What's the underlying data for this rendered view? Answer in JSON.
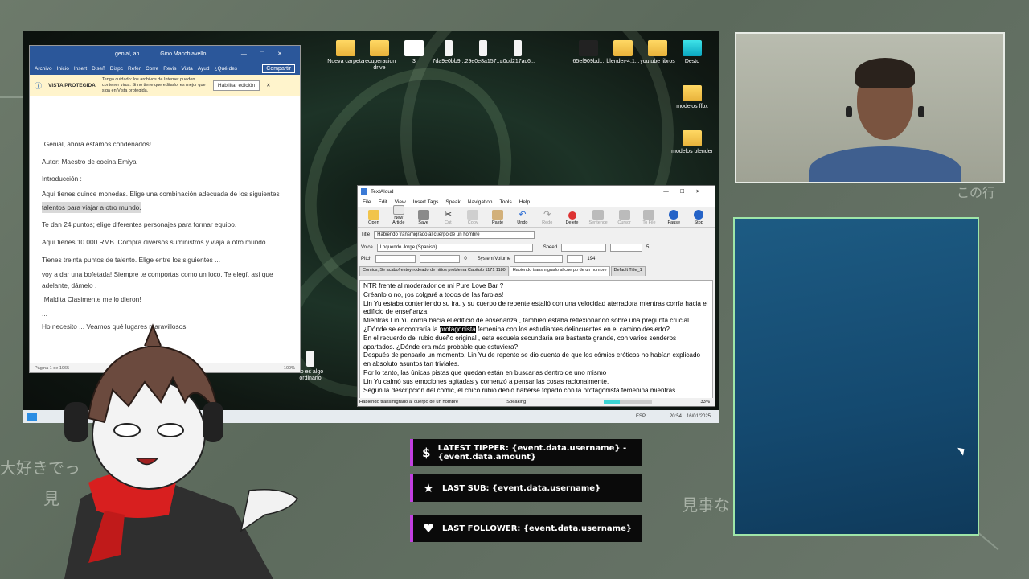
{
  "desktop": {
    "icons": [
      {
        "label": "Nueva carpeta",
        "kind": "folder"
      },
      {
        "label": "recuperacion drive",
        "kind": "folder"
      },
      {
        "label": "3",
        "kind": "app"
      },
      {
        "label": "7da9e0bb9...",
        "kind": "file"
      },
      {
        "label": "29e0e8a157...",
        "kind": "file"
      },
      {
        "label": "c0cd217ac6...",
        "kind": "file"
      },
      {
        "label": "65ef909bd...",
        "kind": "app"
      },
      {
        "label": "blender-4.1...",
        "kind": "folder"
      },
      {
        "label": "youtube libros",
        "kind": "folder"
      },
      {
        "label": "Desto",
        "kind": "app"
      },
      {
        "label": "modelos ffbx",
        "kind": "folder"
      },
      {
        "label": "modelos blender",
        "kind": "folder"
      },
      {
        "label": "no es algo ordinario",
        "kind": "file"
      }
    ],
    "taskbar": {
      "lang": "ESP",
      "time": "20:54",
      "date": "16/01/2025"
    }
  },
  "word": {
    "title": "genial, ah...",
    "user": "Gino Macchiavello",
    "tabs": [
      "Archivo",
      "Inicio",
      "Insert",
      "Diseñ",
      "Dispc",
      "Refer",
      "Corre",
      "Revis",
      "Vista",
      "Ayud",
      "¿Qué des"
    ],
    "share_label": "Compartir",
    "protected_title": "VISTA PROTEGIDA",
    "protected_msg": "Tenga cuidado: los archivos de Internet pueden contener virus. Si no tiene que editarlo, es mejor que siga en Vista protegida.",
    "enable_button": "Habilitar edición",
    "lines": [
      "¡Genial, ahora estamos condenados!",
      "Autor: Maestro de cocina Emiya",
      "Introducción :",
      "Aquí tienes quince monedas. Elige una combinación adecuada de los siguientes",
      "talentos para viajar a otro mundo.",
      "Te dan 24 puntos; elige diferentes personajes para formar equipo.",
      "Aquí tienes 10.000 RMB. Compra diversos suministros y viaja a otro mundo.",
      "Tienes treinta puntos de talento. Elige entre los siguientes ...",
      "voy a dar una bofetada! Siempre te comportas como un loco. Te elegí, así que",
      "adelante, dámelo .",
      "¡Maldita Clasimente me lo dieron!",
      "...",
      "Ho necesito ... Veamos qué lugares maravillosos"
    ],
    "status_page": "Página 1 de 1965",
    "zoom": "100%"
  },
  "textaloud": {
    "title": "TextAloud",
    "menu": [
      "File",
      "Edit",
      "View",
      "Insert Tags",
      "Speak",
      "Navigation",
      "Tools",
      "Help"
    ],
    "toolbar": [
      "Open",
      "New Article",
      "Save",
      "Cut",
      "Copy",
      "Paste",
      "Undo",
      "Redo",
      "Delete",
      "Sentence",
      "Cursor",
      "To File",
      "Pause",
      "Stop"
    ],
    "title_label": "Title",
    "title_value": "Habiendo transmigrado al cuerpo de un hombre",
    "voice_label": "Voice",
    "voice_value": "Loquendo Jorge (Spanish)",
    "speed_label": "Speed",
    "speed_value": "5",
    "pitch_label": "Pitch",
    "pitch_value": "0",
    "volume_label": "System Volume",
    "volume_value": "194",
    "tabs": [
      "Comics; Se acabo! estoy rodeado de niños problema Capitulo 1171 1180",
      "Habiendo transmigrado al cuerpo de un hombre",
      "Default Title_1"
    ],
    "text_before": "NTR frente al moderador de mi Pure Love Bar ?\nCréanlo o no, ¡os colgaré a todos de las farolas!\nLin Yu estaba conteniendo su ira, y su cuerpo de repente estalló con una velocidad aterradora mientras corría hacia el edificio de enseñanza.\nMientras Lin Yu corría hacia el edificio de enseñanza , también estaba reflexionando sobre una pregunta crucial.\n¿Dónde se encontraría la ",
    "highlight": "protagonista",
    "text_after": " femenina con los estudiantes delincuentes en el camino desierto?\nEn el recuerdo del rubio dueño original , esta escuela secundaria era bastante grande, con varios senderos apartados. ¿Dónde era más probable que estuviera?\nDespués de pensarlo un momento, Lin Yu de repente se dio cuenta de que los cómics eróticos no habían explicado en absoluto asuntos tan triviales.\nPor lo tanto, las únicas pistas que quedan están en buscarlas dentro de uno mismo\nLin Yu calmó sus emociones agitadas y comenzó a pensar las cosas racionalmente.\nSegún la descripción del cómic, el chico rubio debió haberse topado con la protagonista femenina mientras",
    "status_title": "Habiendo transmigrado al cuerpo de un hombre",
    "status_state": "Speaking",
    "progress_pct": "33%"
  },
  "alerts": {
    "tipper": "LATEST TIPPER: {event.data.username} - {event.data.amount}",
    "sub": "LAST SUB: {event.data.username}",
    "follower": "LAST FOLLOWER: {event.data.username}"
  },
  "overlay_text": {
    "left_jp": "大好きでっ",
    "left_jp2": "見",
    "right_jp": "この行",
    "right_jp2": "見事な"
  },
  "colors": {
    "accent": "#c23fe0",
    "panel_border": "#9fe6a8",
    "word_blue": "#2b579a"
  }
}
